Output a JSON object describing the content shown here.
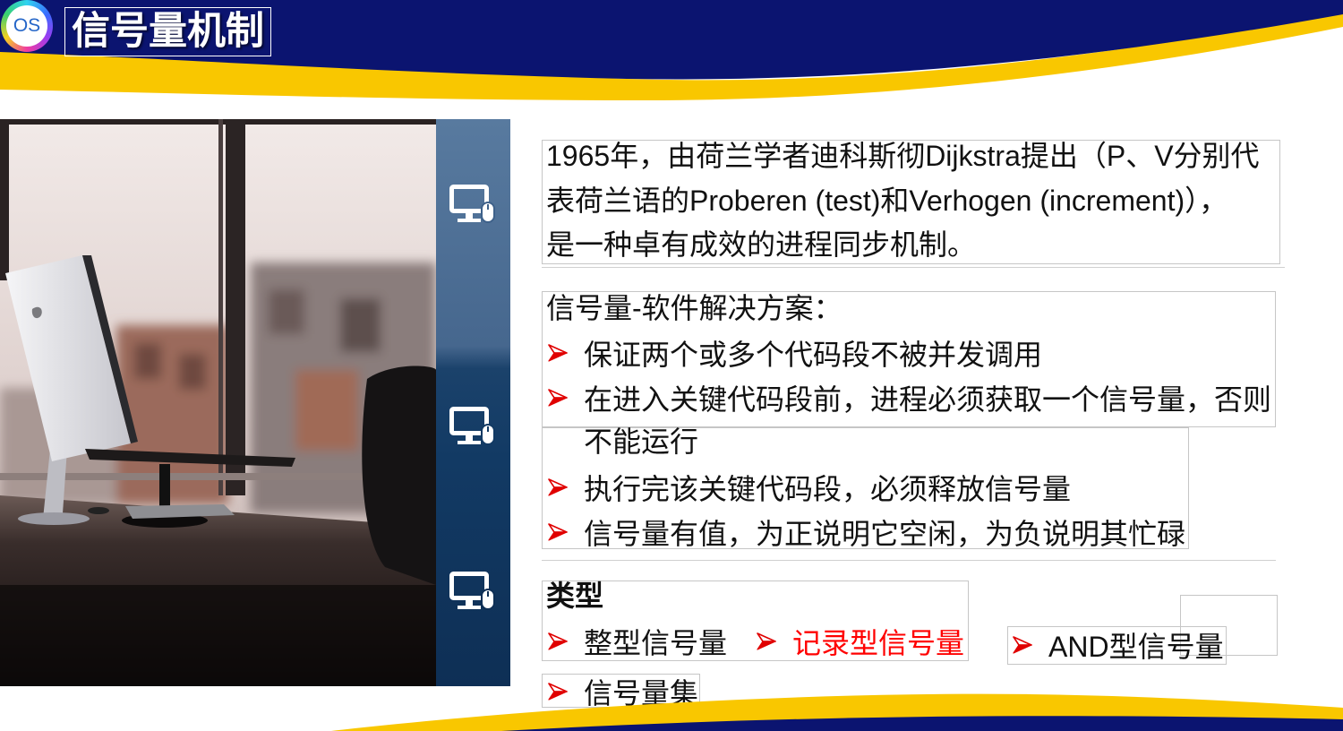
{
  "header": {
    "logo_text": "OS",
    "title": "信号量机制"
  },
  "side_panel": {
    "icons": [
      "monitor-mouse-icon",
      "monitor-mouse-icon",
      "monitor-mouse-icon"
    ]
  },
  "intro": {
    "lines": [
      "1965年，由荷兰学者迪科斯彻Dijkstra提出（P、V分别代",
      "表荷兰语的Proberen (test)和Verhogen (increment)），",
      "是一种卓有成效的进程同步机制。"
    ]
  },
  "software_solution": {
    "heading": "信号量-软件解决方案：",
    "bullets": [
      {
        "lines": [
          "保证两个或多个代码段不被并发调用"
        ]
      },
      {
        "lines": [
          "在进入关键代码段前，进程必须获取一个信号量，否则",
          "不能运行"
        ]
      },
      {
        "lines": [
          "执行完该关键代码段，必须释放信号量"
        ]
      },
      {
        "lines": [
          "信号量有值，为正说明它空闲，为负说明其忙碌"
        ]
      }
    ]
  },
  "types": {
    "heading": "类型",
    "items": [
      {
        "label": "整型信号量",
        "highlight": false
      },
      {
        "label": "记录型信号量",
        "highlight": true
      },
      {
        "label": "AND型信号量",
        "highlight": false
      },
      {
        "label": "信号量集",
        "highlight": false
      }
    ]
  },
  "bullet_icon": "red-arrowhead-bullet-icon",
  "theme": {
    "navy": "#0b1470",
    "yellow": "#f9c700",
    "panel": "#123a64",
    "bullet_red": "#e00000",
    "highlight_red": "#ff0000"
  }
}
